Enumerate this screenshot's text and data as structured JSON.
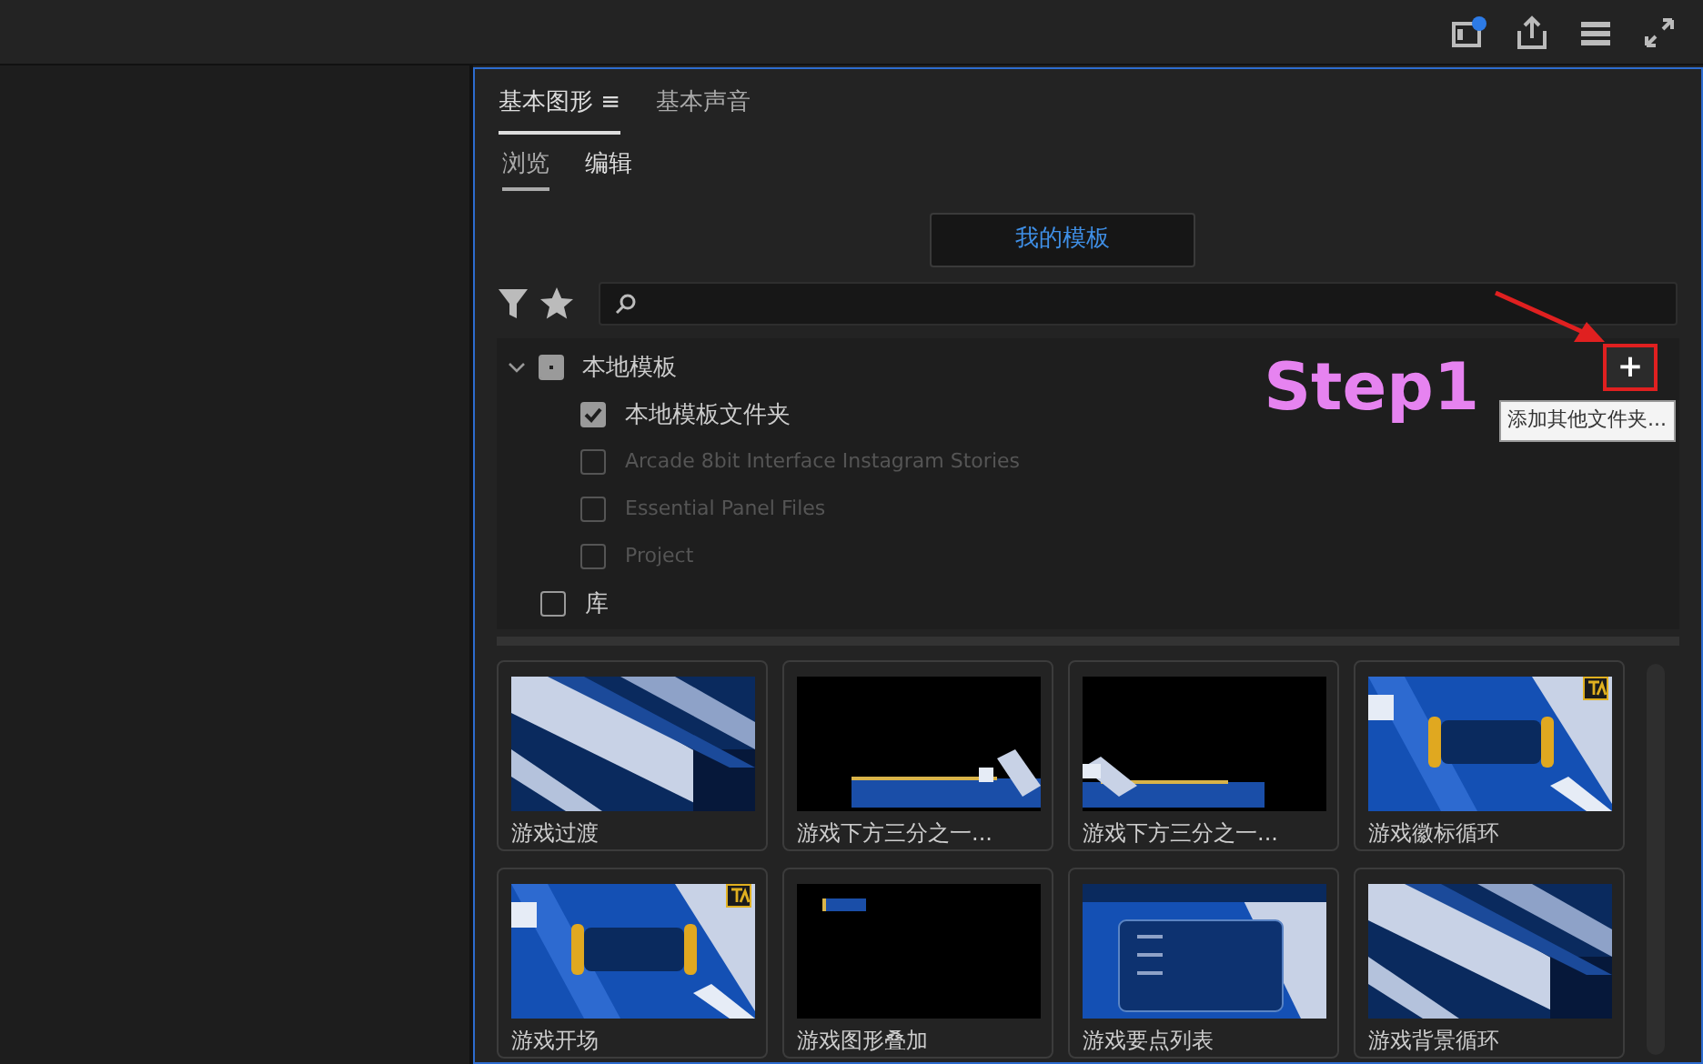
{
  "toolbar": {
    "notification": true
  },
  "panel": {
    "tabs": [
      {
        "label": "基本图形",
        "selected": true,
        "menu": "≡"
      },
      {
        "label": "基本声音",
        "selected": false
      }
    ],
    "subtabs": [
      {
        "label": "浏览",
        "selected": true
      },
      {
        "label": "编辑",
        "selected": false
      }
    ],
    "location_button": "我的模板",
    "tree": [
      {
        "label": "本地模板",
        "expanded": true,
        "partial": true,
        "children": [
          {
            "label": "本地模板文件夹",
            "checked": true,
            "disabled": false
          },
          {
            "label": "Arcade 8bit Interface Instagram Stories",
            "checked": false,
            "disabled": true
          },
          {
            "label": "Essential Panel Files",
            "checked": false,
            "disabled": true
          },
          {
            "label": "Project",
            "checked": false,
            "disabled": true
          }
        ]
      },
      {
        "label": "库",
        "checked": false
      }
    ],
    "add_button": {
      "label": "+",
      "tooltip": "添加其他文件夹..."
    },
    "annotation": {
      "label": "Step1"
    },
    "templates": [
      {
        "name": "游戏过渡",
        "badge": false
      },
      {
        "name": "游戏下方三分之一...",
        "badge": false
      },
      {
        "name": "游戏下方三分之一...",
        "badge": false
      },
      {
        "name": "游戏徽标循环",
        "badge": true
      },
      {
        "name": "游戏开场",
        "badge": true
      },
      {
        "name": "游戏图形叠加",
        "badge": false
      },
      {
        "name": "游戏要点列表",
        "badge": false
      },
      {
        "name": "游戏背景循环",
        "badge": false
      }
    ]
  }
}
